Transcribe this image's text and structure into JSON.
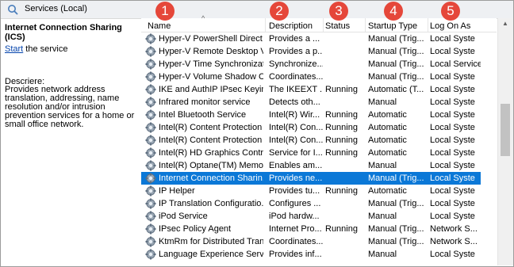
{
  "window": {
    "title": "Services (Local)"
  },
  "left_pane": {
    "service_title": "Internet Connection Sharing (ICS)",
    "start_link": "Start",
    "start_suffix": " the service",
    "description_label": "Descriere:",
    "description": "Provides network address translation, addressing, name resolution and/or intrusion prevention services for a home or small office network."
  },
  "columns": {
    "name": "Name",
    "description": "Description",
    "status": "Status",
    "startup_type": "Startup Type",
    "log_on_as": "Log On As"
  },
  "badges": [
    "1",
    "2",
    "3",
    "4",
    "5"
  ],
  "rows": [
    {
      "name": "Hyper-V PowerShell Direct ...",
      "description": "Provides a ...",
      "status": "",
      "startup": "Manual (Trig...",
      "logon": "Local Syste"
    },
    {
      "name": "Hyper-V Remote Desktop Vi...",
      "description": "Provides a p...",
      "status": "",
      "startup": "Manual (Trig...",
      "logon": "Local Syste"
    },
    {
      "name": "Hyper-V Time Synchronizat...",
      "description": "Synchronize...",
      "status": "",
      "startup": "Manual (Trig...",
      "logon": "Local Service"
    },
    {
      "name": "Hyper-V Volume Shadow C...",
      "description": "Coordinates...",
      "status": "",
      "startup": "Manual (Trig...",
      "logon": "Local Syste"
    },
    {
      "name": "IKE and AuthIP IPsec Keying...",
      "description": "The IKEEXT ...",
      "status": "Running",
      "startup": "Automatic (T...",
      "logon": "Local Syste"
    },
    {
      "name": "Infrared monitor service",
      "description": "Detects oth...",
      "status": "",
      "startup": "Manual",
      "logon": "Local Syste"
    },
    {
      "name": "Intel Bluetooth Service",
      "description": "Intel(R) Wir...",
      "status": "Running",
      "startup": "Automatic",
      "logon": "Local Syste"
    },
    {
      "name": "Intel(R) Content Protection ...",
      "description": "Intel(R) Con...",
      "status": "Running",
      "startup": "Automatic",
      "logon": "Local Syste"
    },
    {
      "name": "Intel(R) Content Protection ...",
      "description": "Intel(R) Con...",
      "status": "Running",
      "startup": "Automatic",
      "logon": "Local Syste"
    },
    {
      "name": "Intel(R) HD Graphics Contro...",
      "description": "Service for I...",
      "status": "Running",
      "startup": "Automatic",
      "logon": "Local Syste"
    },
    {
      "name": "Intel(R) Optane(TM) Memo...",
      "description": "Enables am...",
      "status": "",
      "startup": "Manual",
      "logon": "Local Syste"
    },
    {
      "name": "Internet Connection Sharin...",
      "description": "Provides ne...",
      "status": "",
      "startup": "Manual (Trig...",
      "logon": "Local Syste",
      "selected": true
    },
    {
      "name": "IP Helper",
      "description": "Provides tu...",
      "status": "Running",
      "startup": "Automatic",
      "logon": "Local Syste"
    },
    {
      "name": "IP Translation Configuratio...",
      "description": "Configures ...",
      "status": "",
      "startup": "Manual (Trig...",
      "logon": "Local Syste"
    },
    {
      "name": "iPod Service",
      "description": "iPod hardw...",
      "status": "",
      "startup": "Manual",
      "logon": "Local Syste"
    },
    {
      "name": "IPsec Policy Agent",
      "description": "Internet Pro...",
      "status": "Running",
      "startup": "Manual (Trig...",
      "logon": "Network S..."
    },
    {
      "name": "KtmRm for Distributed Tran...",
      "description": "Coordinates...",
      "status": "",
      "startup": "Manual (Trig...",
      "logon": "Network S..."
    },
    {
      "name": "Language Experience Service",
      "description": "Provides inf...",
      "status": "",
      "startup": "Manual",
      "logon": "Local Syste"
    }
  ]
}
